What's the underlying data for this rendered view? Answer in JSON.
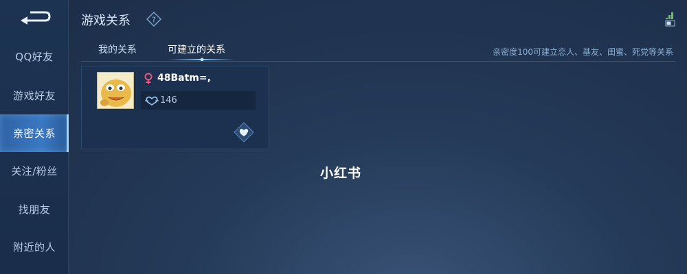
{
  "header": {
    "title": "游戏关系"
  },
  "sidebar": {
    "items": [
      {
        "label": "QQ好友"
      },
      {
        "label": "游戏好友"
      },
      {
        "label": "亲密关系"
      },
      {
        "label": "关注/粉丝"
      },
      {
        "label": "找朋友"
      },
      {
        "label": "附近的人"
      }
    ],
    "active_index": 2
  },
  "tabs": [
    {
      "label": "我的关系"
    },
    {
      "label": "可建立的关系"
    }
  ],
  "active_tab": 1,
  "hint": "亲密度100可建立恋人、基友、闺蜜、死党等关系",
  "card": {
    "name": "48Batm=,",
    "gender": "female-icon",
    "intimacy": "146"
  },
  "watermark": "小红书",
  "colors": {
    "accent": "#3a78c2",
    "female": "#e8557e",
    "card_bg": "#1c3150"
  }
}
